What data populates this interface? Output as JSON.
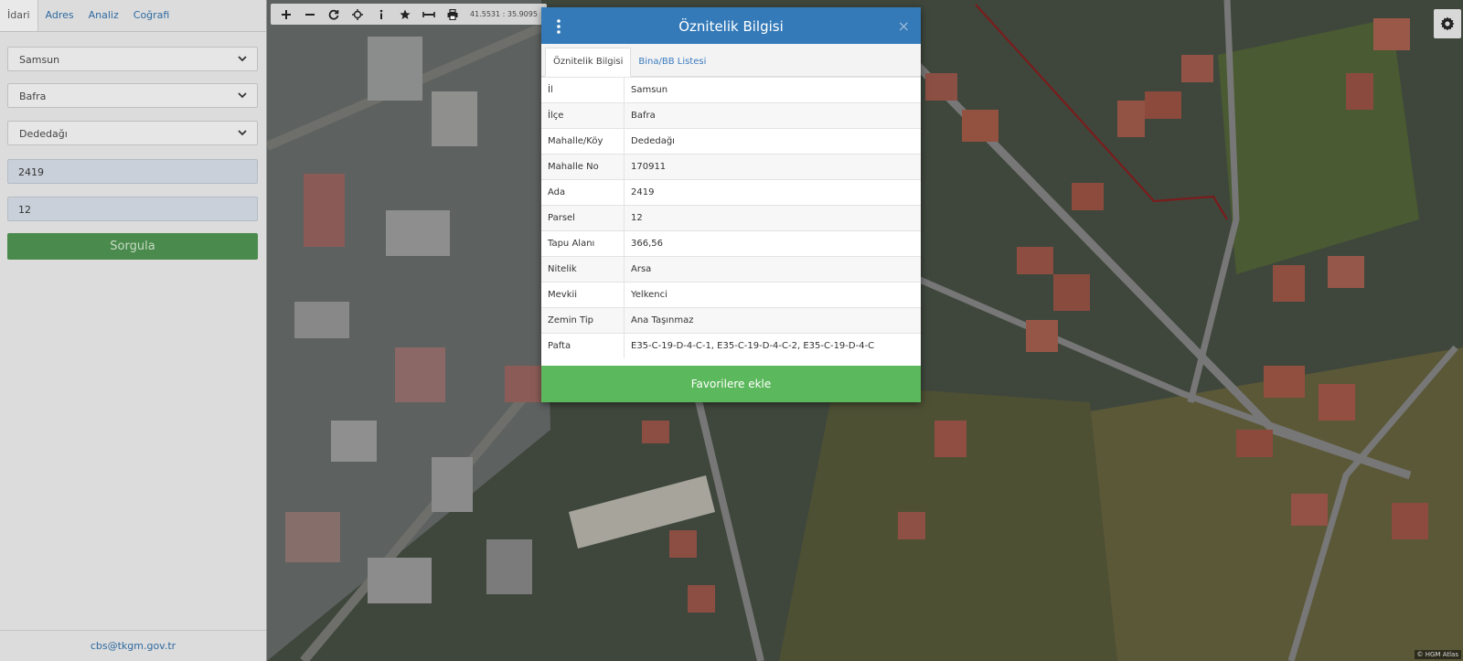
{
  "sidebar": {
    "tabs": [
      {
        "label": "İdari"
      },
      {
        "label": "Adres"
      },
      {
        "label": "Analiz"
      },
      {
        "label": "Coğrafi"
      }
    ],
    "il_select": "Samsun",
    "ilce_select": "Bafra",
    "mahalle_select": "Dededağı",
    "ada_input": "2419",
    "parsel_input": "12",
    "query_button": "Sorgula",
    "footer_email": "cbs@tkgm.gov.tr"
  },
  "map": {
    "toolbar": {
      "icons": [
        "zoom-in-icon",
        "zoom-out-icon",
        "refresh-icon",
        "locate-icon",
        "info-icon",
        "star-icon",
        "measure-icon",
        "print-icon"
      ],
      "coordinates": "41.5531 : 35.9095"
    },
    "attribution": "© HGM Atlas"
  },
  "dialog": {
    "title": "Öznitelik Bilgisi",
    "close": "×",
    "tabs": [
      {
        "label": "Öznitelik Bilgisi",
        "active": true
      },
      {
        "label": "Bina/BB Listesi",
        "active": false
      }
    ],
    "rows": [
      {
        "key": "İl",
        "value": "Samsun"
      },
      {
        "key": "İlçe",
        "value": "Bafra"
      },
      {
        "key": "Mahalle/Köy",
        "value": "Dededağı"
      },
      {
        "key": "Mahalle No",
        "value": "170911"
      },
      {
        "key": "Ada",
        "value": "2419"
      },
      {
        "key": "Parsel",
        "value": "12"
      },
      {
        "key": "Tapu Alanı",
        "value": "366,56"
      },
      {
        "key": "Nitelik",
        "value": "Arsa"
      },
      {
        "key": "Mevkii",
        "value": "Yelkenci"
      },
      {
        "key": "Zemin Tip",
        "value": "Ana Taşınmaz"
      },
      {
        "key": "Pafta",
        "value": "E35-C-19-D-4-C-1, E35-C-19-D-4-C-2, E35-C-19-D-4-C"
      }
    ],
    "favorite_button": "Favorilere ekle"
  },
  "colors": {
    "dialog_header": "#347ab8",
    "favorite_button": "#5cb85c",
    "query_button": "#4a8a4c",
    "link": "#3a7bbf"
  }
}
